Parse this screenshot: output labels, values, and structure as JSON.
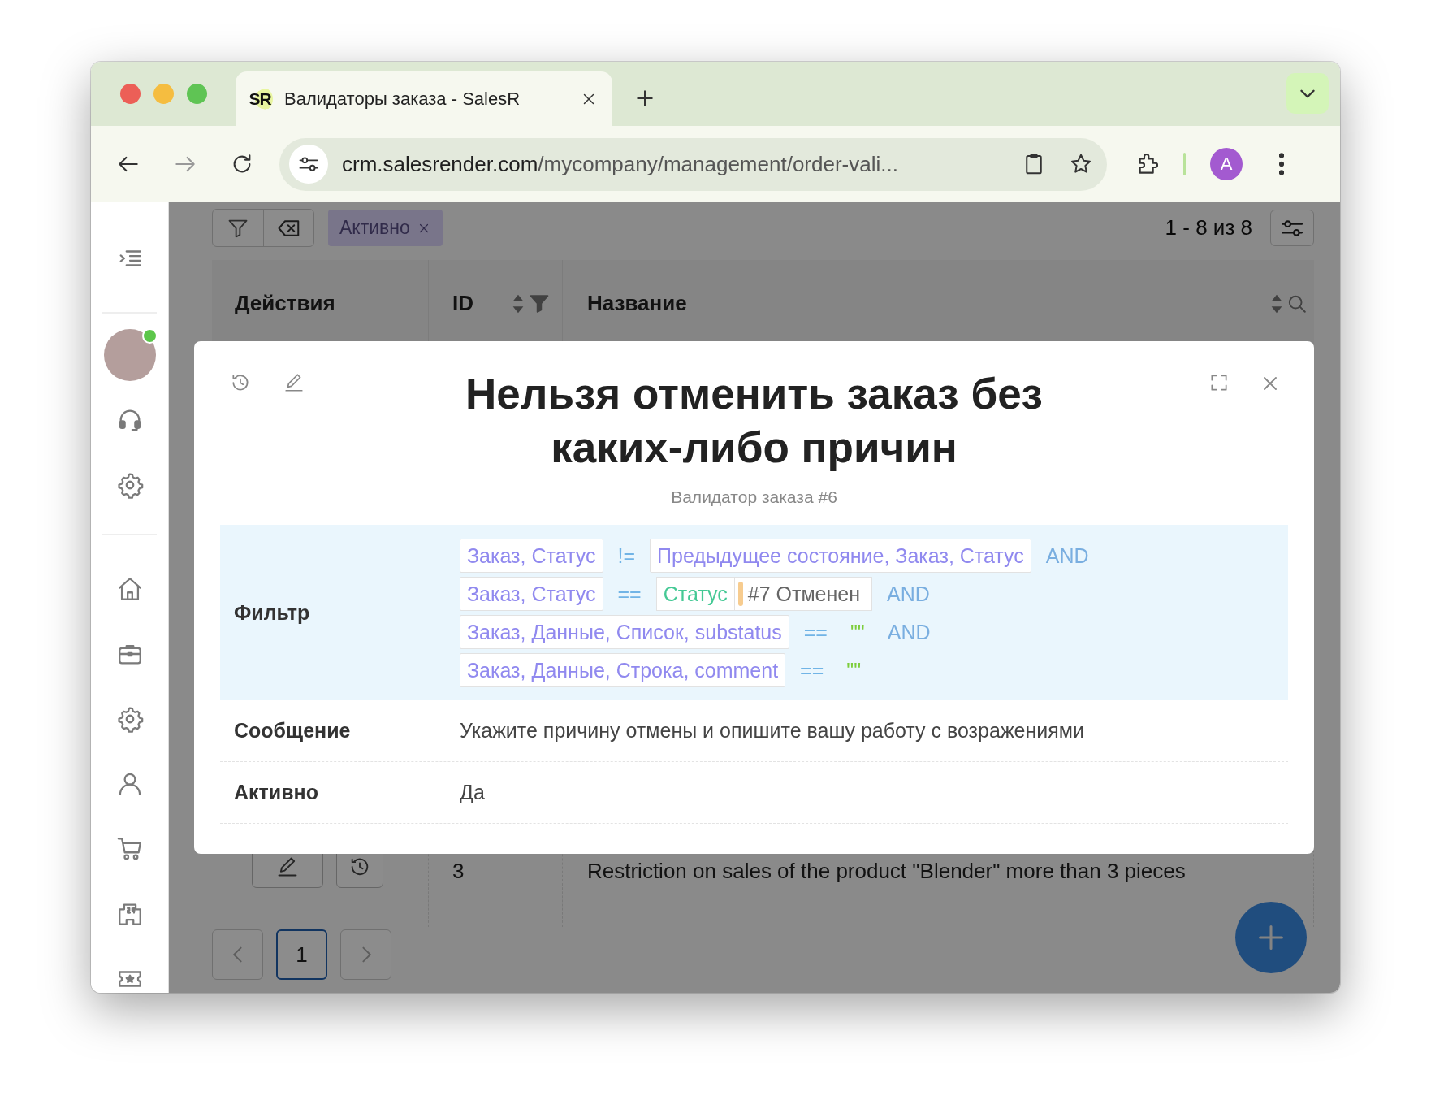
{
  "browser": {
    "tabs": [
      {
        "title": "Валидаторы заказа - SalesR",
        "favicon": "SR",
        "selected": true
      }
    ],
    "url_host": "crm.salesrender.com",
    "url_path": "/mycompany/management/order-vali...",
    "profile": "A"
  },
  "sidebar": {
    "user": {
      "online": true
    }
  },
  "toolbar": {
    "filters": [
      {
        "label": "Активно"
      }
    ],
    "range": "1 - 8 из 8"
  },
  "table": {
    "columns": [
      {
        "label": "Действия",
        "kind": "plain"
      },
      {
        "label": "ID",
        "kind": "filterable"
      },
      {
        "label": "Название",
        "kind": "searchable"
      }
    ],
    "rows": [
      {
        "id": "3",
        "name": "Restriction on sales of the product \"Blender\" more than 3 pieces"
      }
    ]
  },
  "pagination": {
    "pages": [
      {
        "label": "1",
        "selected": true
      }
    ]
  },
  "modal": {
    "title": "Нельзя отменить заказ без каких-либо причин",
    "subtitle": "Валидатор заказа #6",
    "fields": [
      {
        "kind": "filter",
        "label": "Фильтр",
        "conditions": [
          [
            {
              "kind": "field",
              "text": "Заказ, Статус"
            },
            {
              "kind": "operator",
              "text": "!="
            },
            {
              "kind": "field",
              "text": "Предыдущее состояние, Заказ, Статус"
            },
            {
              "kind": "logic",
              "text": "AND"
            }
          ],
          [
            {
              "kind": "field",
              "text": "Заказ, Статус"
            },
            {
              "kind": "operator",
              "text": "=="
            },
            {
              "kind": "status",
              "entity": "Статус",
              "text": "#7 Отменен"
            },
            {
              "kind": "logic",
              "text": "AND"
            }
          ],
          [
            {
              "kind": "field",
              "text": "Заказ, Данные, Список, substatus"
            },
            {
              "kind": "operator",
              "text": "=="
            },
            {
              "kind": "string",
              "text": "\"\""
            },
            {
              "kind": "logic",
              "text": "AND"
            }
          ],
          [
            {
              "kind": "field",
              "text": "Заказ, Данные, Строка, comment"
            },
            {
              "kind": "operator",
              "text": "=="
            },
            {
              "kind": "string",
              "text": "\"\""
            }
          ]
        ]
      },
      {
        "kind": "text",
        "label": "Сообщение",
        "value": "Укажите причину отмены и опишите вашу работу с возражениями"
      },
      {
        "kind": "text",
        "label": "Активно",
        "value": "Да"
      }
    ]
  }
}
